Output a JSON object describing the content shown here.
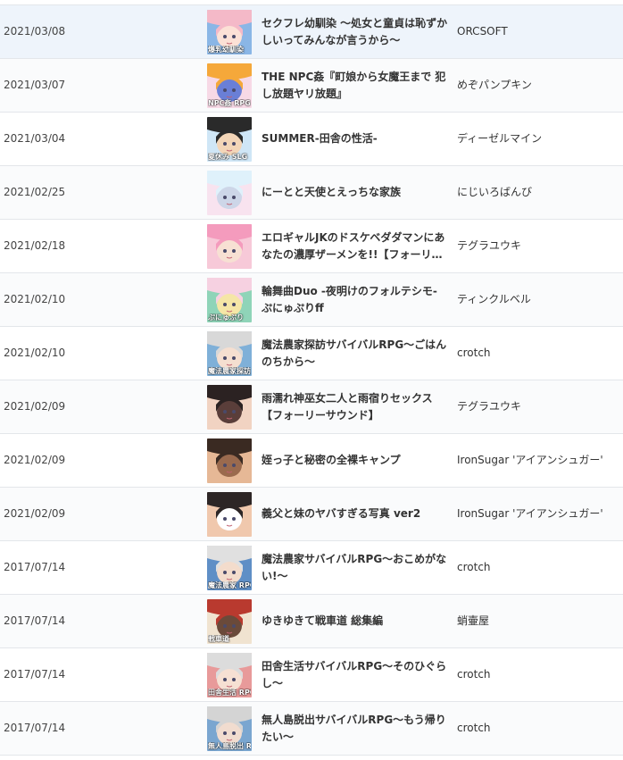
{
  "rows": [
    {
      "date": "2021/03/08",
      "title": "セクフレ幼馴染 ～処女と童貞は恥ずかしいってみんなが言うから～",
      "maker": "ORCSOFT",
      "thumb_icon": "game-cover-icon",
      "thumb_text": "爆乳幼馴染",
      "thumb_colors": [
        "#f4b9c8",
        "#8ab6e6",
        "#fce1d6"
      ]
    },
    {
      "date": "2021/03/07",
      "title": "THE NPC姦『町娘から女魔王まで 犯し放題ヤリ放題』",
      "maker": "めぞパンプキン",
      "thumb_icon": "game-cover-icon",
      "thumb_text": "NPC姦 RPG",
      "thumb_colors": [
        "#f5a83a",
        "#f7d9e6",
        "#6a7fd6"
      ]
    },
    {
      "date": "2021/03/04",
      "title": "SUMMER-田舎の性活-",
      "maker": "ディーゼルマイン",
      "thumb_icon": "game-cover-icon",
      "thumb_text": "夏休み SLG",
      "thumb_colors": [
        "#2a2a2a",
        "#cfe6f6",
        "#f3d5b7"
      ]
    },
    {
      "date": "2021/02/25",
      "title": "にーとと天使とえっちな家族",
      "maker": "にじいろばんび",
      "thumb_icon": "game-cover-icon",
      "thumb_text": "",
      "thumb_colors": [
        "#dff1fb",
        "#f8e3ef",
        "#cdd6e8"
      ]
    },
    {
      "date": "2021/02/18",
      "title": "エロギャルJKのドスケベダダマンにあなたの濃厚ザーメンを!!【フォーリーサウンド】",
      "maker": "テグラユウキ",
      "thumb_icon": "game-cover-icon",
      "thumb_text": "",
      "thumb_colors": [
        "#f49bbd",
        "#f7c9d8",
        "#f7e0d3"
      ]
    },
    {
      "date": "2021/02/10",
      "title": "輪舞曲Duo -夜明けのフォルテシモ- ぷにゅぷりff",
      "maker": "ティンクルベル",
      "thumb_icon": "game-cover-icon",
      "thumb_text": "ぷにゅぷり",
      "thumb_colors": [
        "#f6d1e1",
        "#8fd4b8",
        "#f5e6a6"
      ]
    },
    {
      "date": "2021/02/10",
      "title": "魔法農家探訪サバイバルRPG～ごはんのちから～",
      "maker": "crotch",
      "thumb_icon": "game-cover-icon",
      "thumb_text": "魔法農家探訪 RPG",
      "thumb_colors": [
        "#d8d8d8",
        "#7fb0d8",
        "#f5dfd0"
      ]
    },
    {
      "date": "2021/02/09",
      "title": "雨濡れ神巫女二人と雨宿りセックス【フォーリーサウンド】",
      "maker": "テグラユウキ",
      "thumb_icon": "game-cover-icon",
      "thumb_text": "",
      "thumb_colors": [
        "#2b2222",
        "#f1d3c2",
        "#5a3e3a"
      ]
    },
    {
      "date": "2021/02/09",
      "title": "姪っ子と秘密の全裸キャンプ",
      "maker": "IronSugar 'アイアンシュガー'",
      "thumb_icon": "game-cover-icon",
      "thumb_text": "",
      "thumb_colors": [
        "#3a2a22",
        "#e6b896",
        "#9a6a4e"
      ]
    },
    {
      "date": "2021/02/09",
      "title": "義父と妹のヤバすぎる写真 ver2",
      "maker": "IronSugar 'アイアンシュガー'",
      "thumb_icon": "game-cover-icon",
      "thumb_text": "",
      "thumb_colors": [
        "#2d2626",
        "#f0c8ad",
        "#ffffff"
      ]
    },
    {
      "date": "2017/07/14",
      "title": "魔法農家サバイバルRPG～おこめがない!～",
      "maker": "crotch",
      "thumb_icon": "game-cover-icon",
      "thumb_text": "魔法農家 RPG",
      "thumb_colors": [
        "#e0e0e0",
        "#5f8fc6",
        "#f3dccc"
      ]
    },
    {
      "date": "2017/07/14",
      "title": "ゆきゆきて戦車道 総集編",
      "maker": "蛸壷屋",
      "thumb_icon": "game-cover-icon",
      "thumb_text": "戦車道",
      "thumb_colors": [
        "#b93a2f",
        "#f0e3d0",
        "#6a4a3a"
      ]
    },
    {
      "date": "2017/07/14",
      "title": "田舎生活サバイバルRPG～そのひぐらし～",
      "maker": "crotch",
      "thumb_icon": "game-cover-icon",
      "thumb_text": "田舎生活 RPG",
      "thumb_colors": [
        "#dcdcdc",
        "#e89a9a",
        "#f6e0d3"
      ]
    },
    {
      "date": "2017/07/14",
      "title": "無人島脱出サバイバルRPG～もう帰りたい～",
      "maker": "crotch",
      "thumb_icon": "game-cover-icon",
      "thumb_text": "無人島脱出 RPG",
      "thumb_colors": [
        "#d4d4d4",
        "#7aa6d0",
        "#f1dccf"
      ]
    }
  ]
}
